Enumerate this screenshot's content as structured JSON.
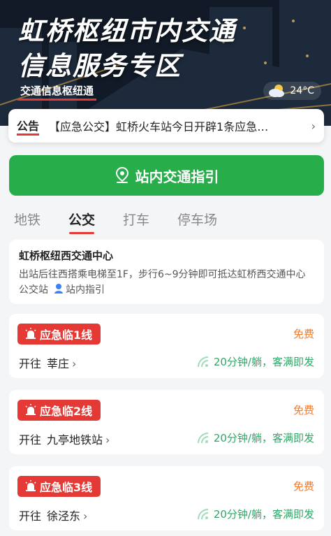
{
  "hero": {
    "title_line1": "虹桥枢纽市内交通",
    "title_line2": "信息服务专区",
    "subtitle": "交通信息枢纽通",
    "weather_icon": "partly-cloudy-icon",
    "temperature": "24°C"
  },
  "notice": {
    "tag": "公告",
    "text": "【应急公交】虹桥火车站今日开辟1条应急…"
  },
  "guide_button": {
    "label": "站内交通指引",
    "icon": "location-pin-icon"
  },
  "tabs": [
    {
      "label": "地铁",
      "active": false
    },
    {
      "label": "公交",
      "active": true
    },
    {
      "label": "打车",
      "active": false
    },
    {
      "label": "停车场",
      "active": false
    }
  ],
  "info": {
    "title": "虹桥枢纽西交通中心",
    "desc": "出站后往西搭乘电梯至1F，步行6~9分钟即可抵达虹桥西交通中心公交站",
    "link": "站内指引"
  },
  "routes": [
    {
      "name": "应急临1线",
      "price": "免费",
      "dest_label": "开往",
      "dest": "莘庄",
      "freq": "20分钟/躺，客满即发"
    },
    {
      "name": "应急临2线",
      "price": "免费",
      "dest_label": "开往",
      "dest": "九亭地铁站",
      "freq": "20分钟/躺，客满即发"
    },
    {
      "name": "应急临3线",
      "price": "免费",
      "dest_label": "开往",
      "dest": "徐泾东",
      "freq": "20分钟/躺，客满即发"
    }
  ],
  "colors": {
    "accent_red": "#e53935",
    "primary_green": "#27ad4a",
    "price_orange": "#f07a2f",
    "freq_green": "#2ea867"
  }
}
